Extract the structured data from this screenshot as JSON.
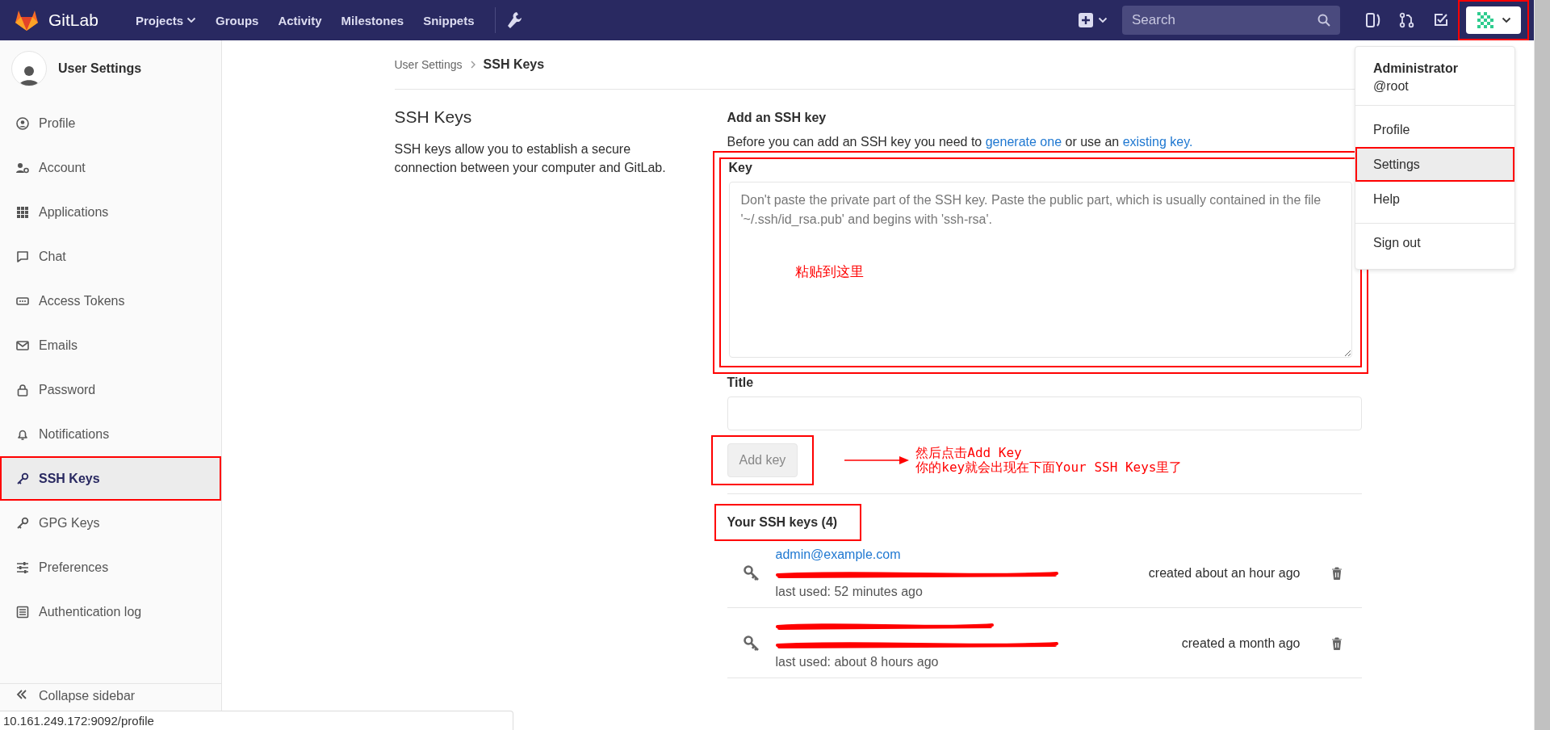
{
  "navbar": {
    "brand": "GitLab",
    "links": [
      {
        "label": "Projects",
        "dropdown": true
      },
      {
        "label": "Groups",
        "dropdown": false
      },
      {
        "label": "Activity",
        "dropdown": false
      },
      {
        "label": "Milestones",
        "dropdown": false
      },
      {
        "label": "Snippets",
        "dropdown": false
      }
    ],
    "search": {
      "placeholder": "Search"
    },
    "user_menu": {
      "expanded": true,
      "annotated": true
    }
  },
  "sidebar": {
    "title": "User Settings",
    "items": [
      {
        "label": "Profile",
        "selected": false,
        "annotated": false
      },
      {
        "label": "Account",
        "selected": false,
        "annotated": false
      },
      {
        "label": "Applications",
        "selected": false,
        "annotated": false
      },
      {
        "label": "Chat",
        "selected": false,
        "annotated": false
      },
      {
        "label": "Access Tokens",
        "selected": false,
        "annotated": false
      },
      {
        "label": "Emails",
        "selected": false,
        "annotated": false
      },
      {
        "label": "Password",
        "selected": false,
        "annotated": false
      },
      {
        "label": "Notifications",
        "selected": false,
        "annotated": false
      },
      {
        "label": "SSH Keys",
        "selected": true,
        "annotated": true
      },
      {
        "label": "GPG Keys",
        "selected": false,
        "annotated": false
      },
      {
        "label": "Preferences",
        "selected": false,
        "annotated": false
      },
      {
        "label": "Authentication log",
        "selected": false,
        "annotated": false
      }
    ],
    "collapse": "Collapse sidebar"
  },
  "breadcrumb": [
    "User Settings",
    "SSH Keys"
  ],
  "intro": {
    "title": "SSH Keys",
    "text": "SSH keys allow you to establish a secure connection between your computer and GitLab."
  },
  "form": {
    "heading": "Add an SSH key",
    "help": [
      {
        "text": "Before you can add an SSH key you need to ",
        "link": false
      },
      {
        "text": "generate one",
        "link": true
      },
      {
        "text": " or use an ",
        "link": false
      },
      {
        "text": "existing key.",
        "link": true
      }
    ],
    "key_label": "Key",
    "key_placeholder": "Don't paste the private part of the SSH key. Paste the public part, which is usually contained in the file '~/.ssh/id_rsa.pub' and begins with 'ssh-rsa'.",
    "key_annotated": true,
    "title_label": "Title",
    "submit": {
      "label": "Add key",
      "disabled": true,
      "annotated": true
    }
  },
  "keys_section": {
    "heading": "Your SSH keys (4)",
    "annotated": true,
    "keys": [
      {
        "email": "admin@example.com",
        "email_redacted": false,
        "fingerprint_redacted": true,
        "last_used": "last used: 52 minutes ago",
        "created": "created about an hour ago"
      },
      {
        "email_redacted": true,
        "fingerprint_redacted": true,
        "last_used": "last used: about 8 hours ago",
        "created": "created a month ago"
      }
    ]
  },
  "annotations": [
    {
      "kind": "note",
      "text": "粘贴到这里"
    },
    {
      "kind": "arrow-note",
      "lines": [
        "然后点击Add Key",
        "你的key就会出现在下面Your SSH Keys里了"
      ]
    }
  ],
  "user_dropdown": {
    "name": "Administrator",
    "username": "@root",
    "items": [
      {
        "label": "Profile",
        "selected": false,
        "annotated": false,
        "divider_before": false
      },
      {
        "label": "Settings",
        "selected": true,
        "annotated": true,
        "divider_before": false
      },
      {
        "label": "Help",
        "selected": false,
        "annotated": false,
        "divider_before": false
      },
      {
        "label": "Sign out",
        "selected": false,
        "annotated": false,
        "divider_before": true
      }
    ]
  },
  "status_bar": {
    "url": "10.161.249.172:9092/profile"
  }
}
